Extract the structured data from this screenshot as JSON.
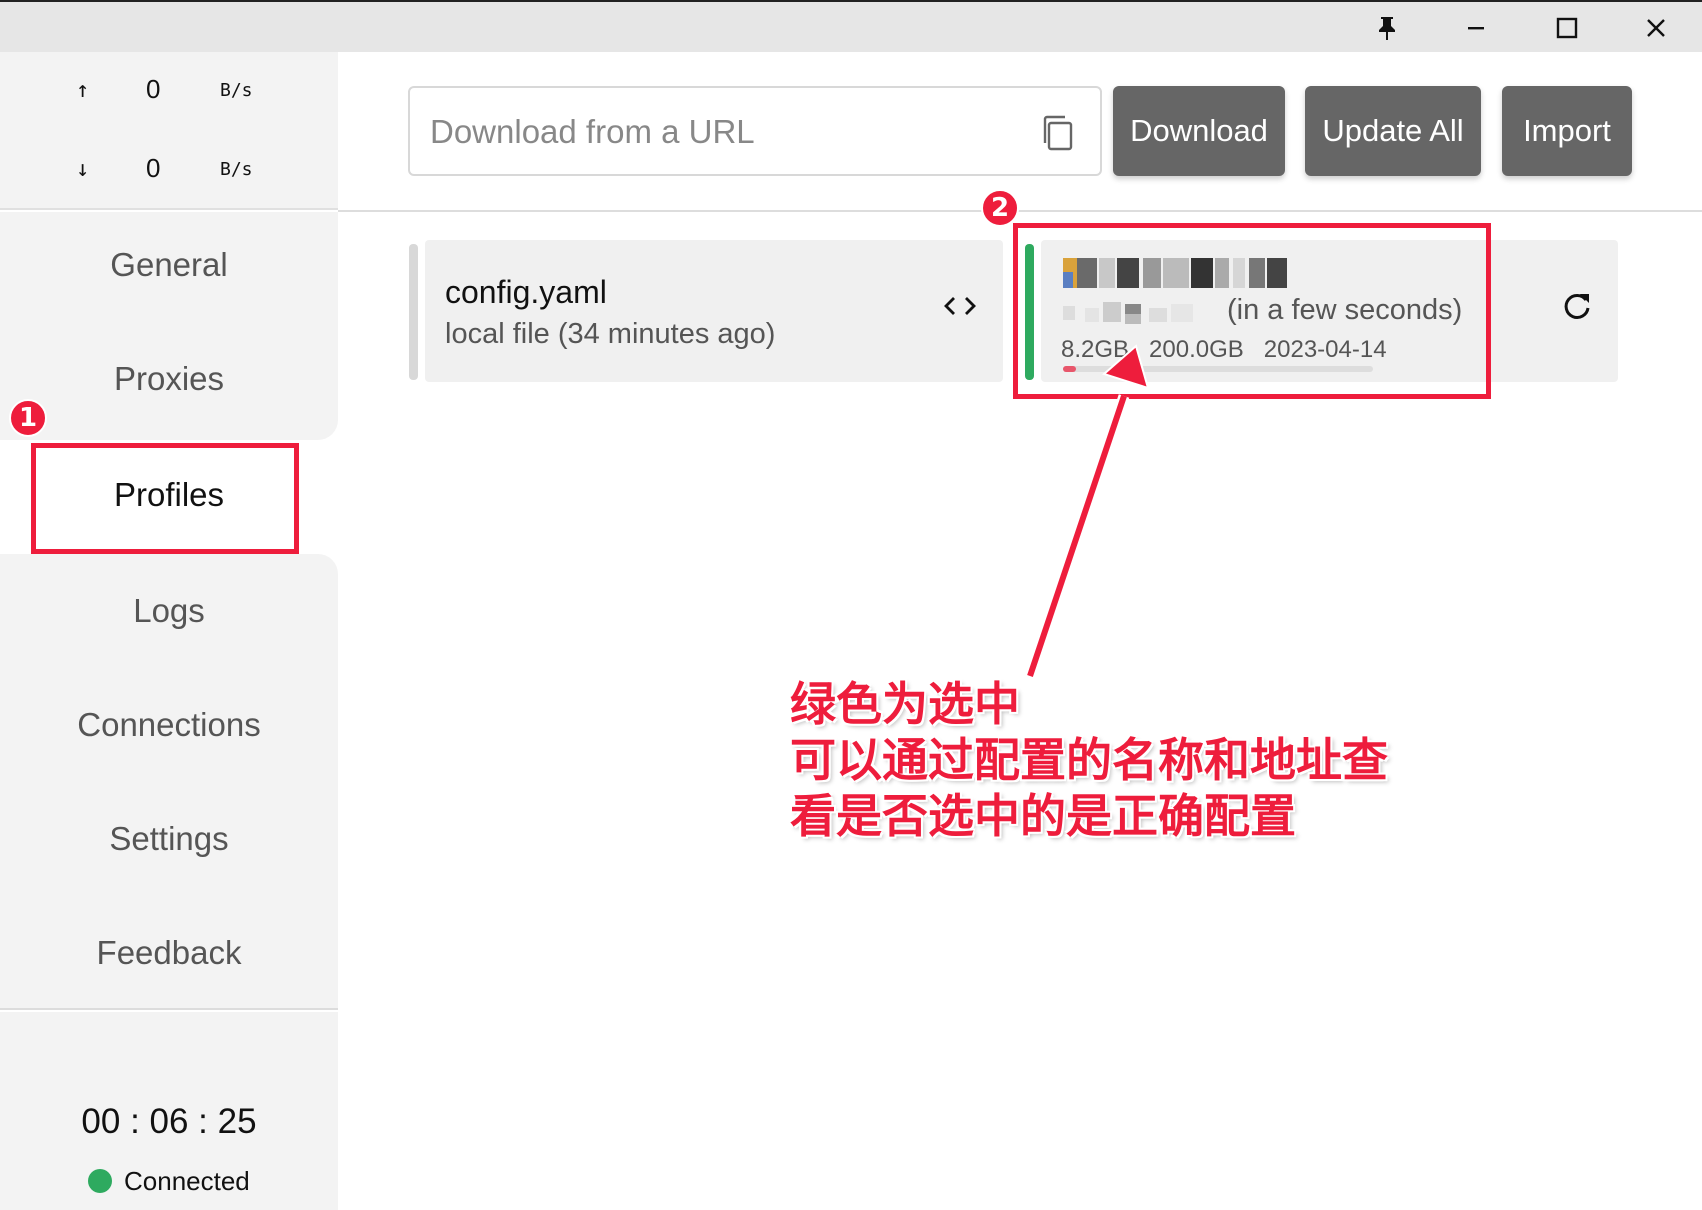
{
  "window": {
    "controls": [
      "pin-icon",
      "minimize-icon",
      "maximize-icon",
      "close-icon"
    ]
  },
  "traffic": {
    "up_arrow": "↑",
    "up_value": "0",
    "up_unit": "B/s",
    "down_arrow": "↓",
    "down_value": "0",
    "down_unit": "B/s"
  },
  "nav": {
    "items": [
      {
        "label": "General"
      },
      {
        "label": "Proxies"
      },
      {
        "label": "Profiles",
        "active": true
      },
      {
        "label": "Logs"
      },
      {
        "label": "Connections"
      },
      {
        "label": "Settings"
      },
      {
        "label": "Feedback"
      }
    ]
  },
  "status": {
    "uptime": "00 : 06 : 25",
    "connection": "Connected",
    "connection_color": "#2eaa5f"
  },
  "header": {
    "url_placeholder": "Download from a URL",
    "url_value": "",
    "download_label": "Download",
    "update_all_label": "Update All",
    "import_label": "Import",
    "button_color": "#666666"
  },
  "profiles": [
    {
      "name": "config.yaml",
      "meta": "local file (34 minutes ago)",
      "selected": false,
      "action_icon": "code-icon"
    },
    {
      "name_blurred": true,
      "updated": "(in a few seconds)",
      "used": "8.2GB",
      "total": "200.0GB",
      "expires": "2023-04-14",
      "usage_fraction": 0.041,
      "selected": true,
      "selected_color": "#2eaa5f",
      "action_icon": "refresh-icon"
    }
  ],
  "annotations": {
    "badge1": "1",
    "badge2": "2",
    "note_line1": "绿色为选中",
    "note_line2": "可以通过配置的名称和地址查",
    "note_line3": "看是否选中的是正确配置",
    "color": "#ee1d3c"
  }
}
